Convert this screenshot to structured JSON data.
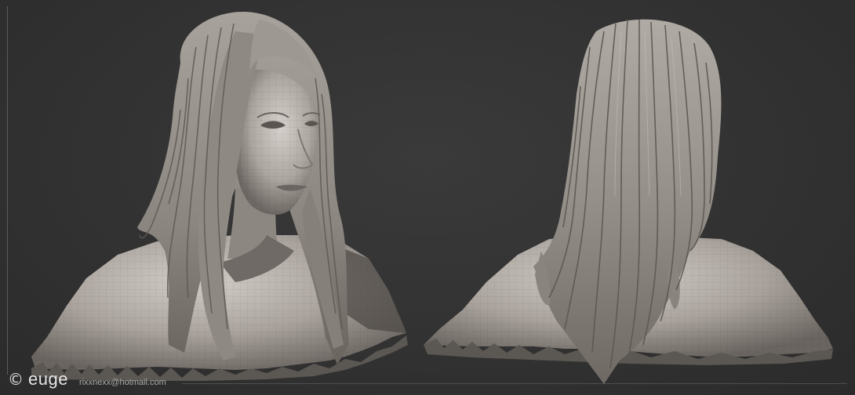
{
  "artwork": {
    "subject": "",
    "views": [
      {
        "id": "three-quarter-front"
      },
      {
        "id": "back"
      }
    ]
  },
  "signature": {
    "logo_glyph": "©",
    "name": "euge",
    "email": "rixxnexx@hotmail.com"
  },
  "colors": {
    "background": "#303030",
    "clay": "#b8b2ad",
    "clay_shadow": "#5e5a56",
    "text": "#e6e6e6",
    "text_muted": "#a9a9a9"
  }
}
